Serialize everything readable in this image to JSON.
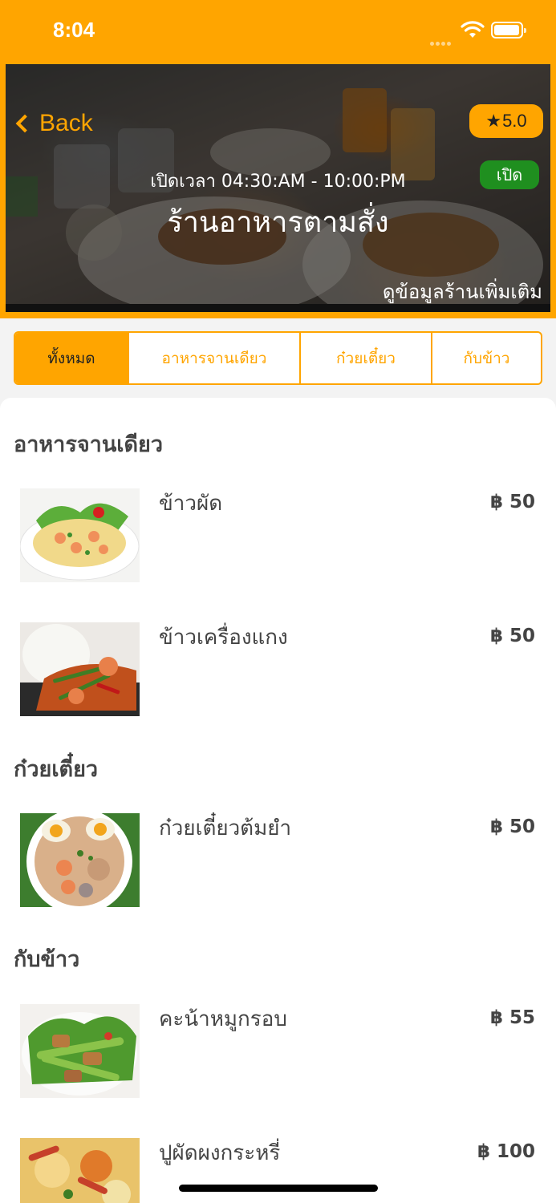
{
  "status_bar": {
    "time": "8:04"
  },
  "header": {
    "back_label": "Back",
    "rating": "5.0",
    "open_status": "เปิด",
    "hours": "เปิดเวลา 04:30:AM - 10:00:PM",
    "shop_name": "ร้านอาหารตามสั่ง",
    "more_info": "ดูข้อมูลร้านเพิ่มเติม"
  },
  "tabs": [
    {
      "label": "ทั้งหมด",
      "active": true
    },
    {
      "label": "อาหารจานเดียว",
      "active": false
    },
    {
      "label": "ก๋วยเตี๋ยว",
      "active": false
    },
    {
      "label": "กับข้าว",
      "active": false
    }
  ],
  "sections": [
    {
      "title": "อาหารจานเดียว",
      "items": [
        {
          "name": "ข้าวผัด",
          "price": "฿ 50",
          "image": "fried-rice-photo"
        },
        {
          "name": "ข้าวเครื่องแกง",
          "price": "฿ 50",
          "image": "rice-with-curry-photo"
        }
      ]
    },
    {
      "title": "ก๋วยเตี๋ยว",
      "items": [
        {
          "name": "ก๋วยเตี๋ยวต้มยำ",
          "price": "฿ 50",
          "image": "tom-yum-noodle-photo"
        }
      ]
    },
    {
      "title": "กับข้าว",
      "items": [
        {
          "name": "คะน้าหมูกรอบ",
          "price": "฿ 55",
          "image": "kale-crispy-pork-photo"
        },
        {
          "name": "ปูผัดผงกระหรี่",
          "price": "฿ 100",
          "image": "crab-curry-powder-photo"
        }
      ]
    }
  ],
  "colors": {
    "accent": "#ffa500",
    "open_green": "#1f8f1f",
    "text": "#444444"
  }
}
